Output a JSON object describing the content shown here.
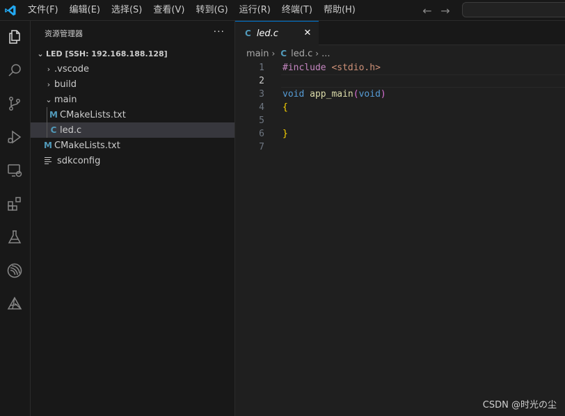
{
  "menu": [
    "文件(F)",
    "编辑(E)",
    "选择(S)",
    "查看(V)",
    "转到(G)",
    "运行(R)",
    "终端(T)",
    "帮助(H)"
  ],
  "nav": {
    "back": "←",
    "forward": "→"
  },
  "activity_bar": [
    "explorer-icon",
    "search-icon",
    "source-control-icon",
    "run-debug-icon",
    "remote-explorer-icon",
    "extensions-icon",
    "testing-icon",
    "espressif-icon",
    "platformio-icon"
  ],
  "sidebar": {
    "title": "资源管理器",
    "more": "···",
    "root_label": "LED [SSH: 192.168.188.128]",
    "items": [
      {
        "label": ".vscode",
        "kind": "folder",
        "expanded": false
      },
      {
        "label": "build",
        "kind": "folder",
        "expanded": false
      },
      {
        "label": "main",
        "kind": "folder",
        "expanded": true
      },
      {
        "label": "CMakeLists.txt",
        "kind": "cmake",
        "icon": "M"
      },
      {
        "label": "led.c",
        "kind": "c",
        "icon": "C",
        "selected": true
      },
      {
        "label": "CMakeLists.txt",
        "kind": "cmake",
        "icon": "M"
      },
      {
        "label": "sdkconfig",
        "kind": "text"
      }
    ]
  },
  "tab": {
    "icon": "C",
    "label": "led.c",
    "close": "✕"
  },
  "breadcrumb": {
    "folder": "main",
    "icon": "C",
    "file": "led.c",
    "more": "..."
  },
  "code": {
    "line_numbers": [
      "1",
      "2",
      "3",
      "4",
      "5",
      "6",
      "7"
    ],
    "active_line": 2,
    "l1": {
      "directive": "#include",
      "space": " ",
      "header": "<stdio.h>"
    },
    "l3": {
      "ret": "void",
      "space": " ",
      "name": "app_main",
      "open": "(",
      "param": "void",
      "close": ")"
    },
    "l4": {
      "brace": "{"
    },
    "l6": {
      "brace": "}"
    }
  },
  "watermark": "CSDN @时光の尘",
  "colors": {
    "accent": "#0078d4",
    "c_icon": "#519aba",
    "keyword": "#569cd6",
    "function": "#dcdcaa",
    "preprocessor": "#c586c0",
    "string": "#ce9178",
    "bracket": "#ffd700"
  }
}
